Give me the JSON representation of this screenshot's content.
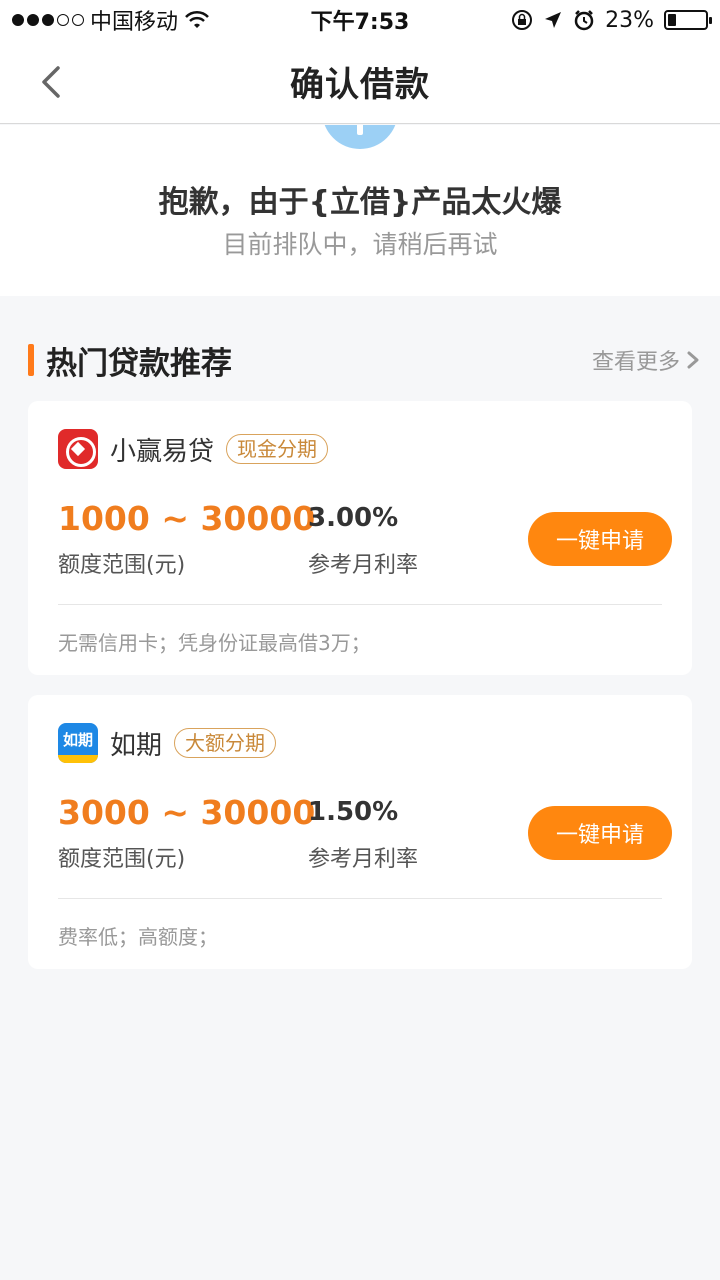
{
  "status_bar": {
    "carrier": "中国移动",
    "time": "下午7:53",
    "battery": "23%",
    "battery_level": 0.23
  },
  "nav": {
    "title": "确认借款"
  },
  "notice": {
    "title": "抱歉，由于{立借}产品太火爆",
    "subtitle": "目前排队中，请稍后再试"
  },
  "section": {
    "title": "热门贷款推荐",
    "more": "查看更多"
  },
  "loans": [
    {
      "name": "小赢易贷",
      "tag": "现金分期",
      "amount": "1000 ~ 30000",
      "amount_label": "额度范围(元)",
      "rate": "3.00%",
      "rate_label": "参考月利率",
      "button": "一键申请",
      "desc": "无需信用卡；凭身份证最高借3万；"
    },
    {
      "name": "如期",
      "tag": "大额分期",
      "logo_text": "如期",
      "amount": "3000 ~ 30000",
      "amount_label": "额度范围(元)",
      "rate": "1.50%",
      "rate_label": "参考月利率",
      "button": "一键申请",
      "desc": "费率低；高额度；"
    }
  ]
}
